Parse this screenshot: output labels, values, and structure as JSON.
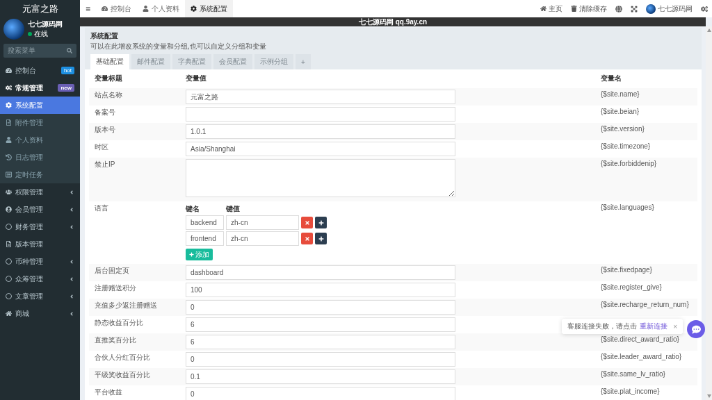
{
  "sidebar": {
    "logo": "元富之路",
    "user": {
      "name": "七七源码网",
      "status": "在线",
      "online": true
    },
    "search": {
      "placeholder": "搜索菜单"
    },
    "items": [
      {
        "label": "控制台",
        "badge": {
          "text": "hot",
          "color": "#1d8fe1"
        },
        "arrow": false
      },
      {
        "label": "常规管理",
        "badge": {
          "text": "new",
          "color": "#6a5fb4"
        },
        "arrow": false,
        "expanded": true,
        "children": [
          {
            "label": "系统配置",
            "selected": true
          },
          {
            "label": "附件管理",
            "selected": false
          },
          {
            "label": "个人资料",
            "selected": false
          },
          {
            "label": "日志管理",
            "selected": false
          },
          {
            "label": "定时任务",
            "selected": false
          }
        ]
      },
      {
        "label": "权限管理",
        "arrow": true
      },
      {
        "label": "会员管理",
        "arrow": true
      },
      {
        "label": "财务管理",
        "arrow": true
      },
      {
        "label": "版本管理",
        "arrow": false
      },
      {
        "label": "币种管理",
        "arrow": true
      },
      {
        "label": "众筹管理",
        "arrow": true
      },
      {
        "label": "文章管理",
        "arrow": true
      },
      {
        "label": "商城",
        "arrow": true
      }
    ]
  },
  "topbar": {
    "menu_icon": "≡",
    "tabs": [
      {
        "label": "控制台",
        "selected": false
      },
      {
        "label": "个人资料",
        "selected": false
      },
      {
        "label": "系统配置",
        "selected": true
      }
    ],
    "right": [
      {
        "kind": "link",
        "label": "主页"
      },
      {
        "kind": "link",
        "label": "清除缓存"
      },
      {
        "kind": "icon"
      },
      {
        "kind": "icon"
      },
      {
        "kind": "user",
        "label": "七七源码网"
      },
      {
        "kind": "icon"
      }
    ]
  },
  "banner": "七七源码网 qq.9ay.cn",
  "panel": {
    "title": "系统配置",
    "description": "可以在此增改系统的变量和分组,也可以自定义分组和变量",
    "tabs": [
      {
        "label": "基础配置",
        "selected": true
      },
      {
        "label": "邮件配置",
        "selected": false
      },
      {
        "label": "字典配置",
        "selected": false
      },
      {
        "label": "会员配置",
        "selected": false
      },
      {
        "label": "示例分组",
        "selected": false
      },
      {
        "label": "+",
        "selected": false
      }
    ],
    "table": {
      "columns": [
        "变量标题",
        "变量值",
        "变量名"
      ],
      "rows": [
        {
          "kind": "input",
          "title": "站点名称",
          "value": "元富之路",
          "name": "{$site.name}"
        },
        {
          "kind": "input",
          "title": "备案号",
          "name": "{$site.beian}"
        },
        {
          "kind": "input",
          "title": "版本号",
          "value": "1.0.1",
          "name": "{$site.version}"
        },
        {
          "kind": "input",
          "title": "时区",
          "value": "Asia/Shanghai",
          "name": "{$site.timezone}"
        },
        {
          "kind": "textarea",
          "title": "禁止IP",
          "name": "{$site.forbiddenip}"
        },
        {
          "kind": "keyvalue",
          "title": "语言",
          "key_header": "键名",
          "value_header": "键值",
          "pairs": [
            {
              "key": "backend",
              "value": "zh-cn"
            },
            {
              "key": "frontend",
              "value": "zh-cn"
            }
          ],
          "add_label": "添加",
          "name": "{$site.languages}"
        },
        {
          "kind": "input",
          "title": "后台固定页",
          "value": "dashboard",
          "name": "{$site.fixedpage}"
        },
        {
          "kind": "input",
          "title": "注册赠送积分",
          "value": "100",
          "name": "{$site.register_give}"
        },
        {
          "kind": "input",
          "title": "充值多少返注册赠送",
          "value": "0",
          "name": "{$site.recharge_return_num}"
        },
        {
          "kind": "input",
          "title": "静态收益百分比",
          "value": "6"
        },
        {
          "kind": "input",
          "title": "直推奖百分比",
          "value": "6",
          "name": "{$site.direct_award_ratio}"
        },
        {
          "kind": "input",
          "title": "合伙人分红百分比",
          "value": "0",
          "name": "{$site.leader_award_ratio}"
        },
        {
          "kind": "input",
          "title": "平级奖收益百分比",
          "value": "0.1",
          "name": "{$site.same_lv_ratio}"
        },
        {
          "kind": "input",
          "title": "平台收益",
          "value": "0",
          "name": "{$site.plat_income}"
        }
      ]
    }
  },
  "toast": {
    "message": "客服连接失败，请点击",
    "link": "重新连接",
    "close": "×"
  }
}
